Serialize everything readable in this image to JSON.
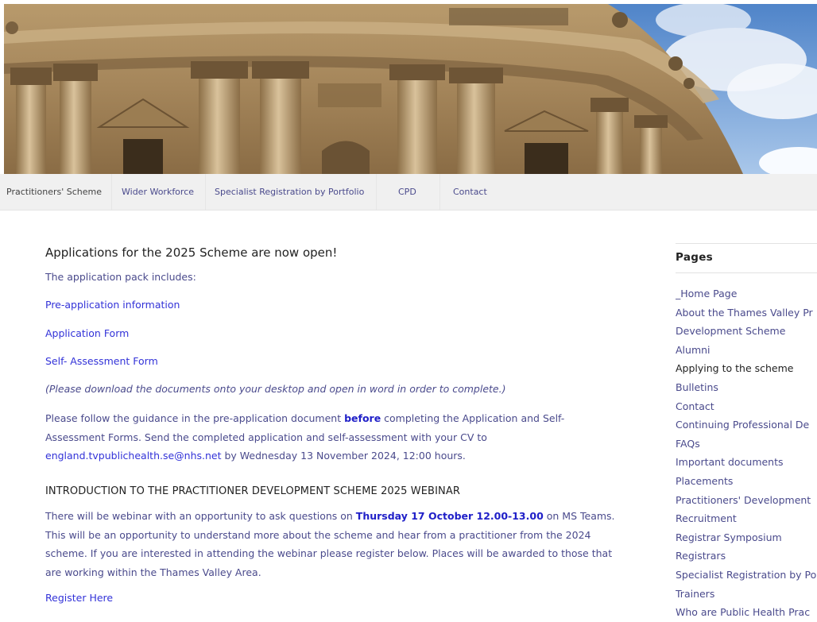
{
  "nav": {
    "items": [
      {
        "label": "Practitioners' Scheme"
      },
      {
        "label": "Wider Workforce"
      },
      {
        "label": "Specialist Registration by Portfolio"
      },
      {
        "label": "CPD"
      },
      {
        "label": "Contact"
      }
    ]
  },
  "main": {
    "heading": "Applications for the 2025 Scheme are now open!",
    "intro": "The application pack includes:",
    "links": [
      {
        "label": "Pre-application information"
      },
      {
        "label": "Application Form"
      },
      {
        "label": "Self- Assessment Form"
      }
    ],
    "note": "(Please download the documents onto your desktop and open in word in order to complete.)",
    "guidance": {
      "part1": "Please follow the guidance in the pre-application document ",
      "bold": "before",
      "part2": " completing the Application and Self-Assessment Forms. Send the completed application and self-assessment with your CV to ",
      "email": "england.tvpublichealth.se@nhs.net",
      "part3": " by Wednesday 13 November 2024, 12:00 hours."
    },
    "webinar_heading": "INTRODUCTION TO THE PRACTITIONER DEVELOPMENT SCHEME 2025 WEBINAR",
    "webinar": {
      "part1": "There will be webinar with an opportunity to ask questions on ",
      "bold": "Thursday 17 October 12.00-13.00",
      "part2": " on MS Teams. This will be an opportunity to understand more about the scheme and hear from a practitioner from the 2024 scheme. If you are interested in attending the webinar please register below. Places will be awarded to those that are working within the Thames Valley Area."
    },
    "register_label": "Register Here"
  },
  "sidebar": {
    "title": "Pages",
    "items": [
      {
        "label": "_Home Page"
      },
      {
        "label": "About the Thames Valley Pr"
      },
      {
        "label": "Development Scheme"
      },
      {
        "label": "Alumni"
      },
      {
        "label": "Applying to the scheme"
      },
      {
        "label": "Bulletins"
      },
      {
        "label": "Contact"
      },
      {
        "label": "Continuing Professional De"
      },
      {
        "label": "FAQs"
      },
      {
        "label": "Important documents"
      },
      {
        "label": "Placements"
      },
      {
        "label": "Practitioners' Development"
      },
      {
        "label": "Recruitment"
      },
      {
        "label": "Registrar Symposium"
      },
      {
        "label": "Registrars"
      },
      {
        "label": "Specialist Registration by Po"
      },
      {
        "label": "Trainers"
      },
      {
        "label": "Who are Public Health Prac"
      }
    ]
  },
  "colors": {
    "link": "#3232d8",
    "text": "#4a4a8c",
    "heading": "#222222",
    "nav_bg": "#f0f0f0"
  }
}
